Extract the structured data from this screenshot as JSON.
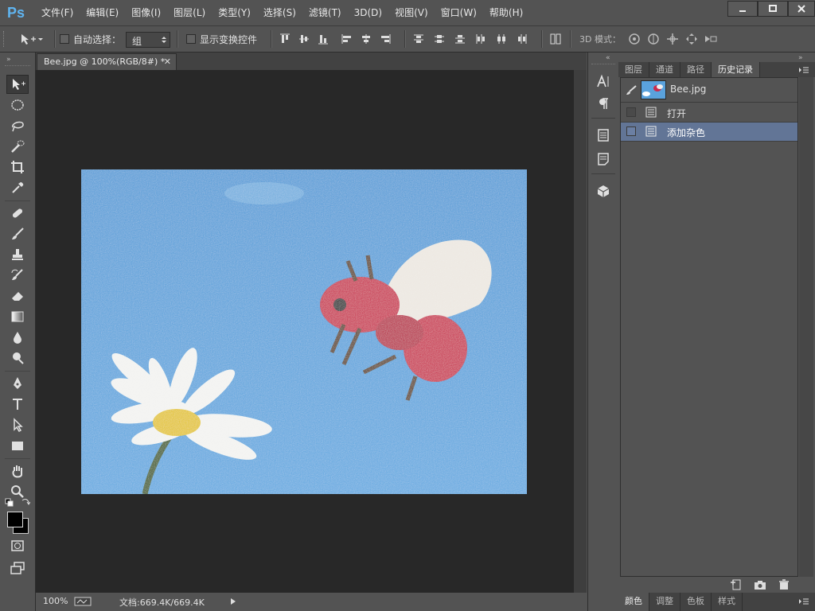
{
  "app": {
    "logo": "Ps"
  },
  "menu": [
    "文件(F)",
    "编辑(E)",
    "图像(I)",
    "图层(L)",
    "类型(Y)",
    "选择(S)",
    "滤镜(T)",
    "3D(D)",
    "视图(V)",
    "窗口(W)",
    "帮助(H)"
  ],
  "window_controls": [
    "minimize-icon",
    "maximize-icon",
    "close-icon"
  ],
  "options": {
    "auto_select_label": "自动选择：",
    "auto_select_value": "组",
    "show_transform_label": "显示变换控件",
    "mode_3d_label": "3D 模式："
  },
  "document": {
    "tab_title": "Bee.jpg @ 100%(RGB/8#) *",
    "zoom": "100%",
    "doc_size": "文档:669.4K/669.4K"
  },
  "panel": {
    "tabs": [
      "图层",
      "通道",
      "路径",
      "历史记录"
    ],
    "active_tab": "历史记录",
    "snapshot_name": "Bee.jpg",
    "history": [
      "打开",
      "添加杂色"
    ],
    "selected_history": "添加杂色"
  },
  "bottom_panel": {
    "tabs": [
      "颜色",
      "调整",
      "色板",
      "样式"
    ],
    "active_tab": "颜色"
  },
  "colors": {
    "accent_selected": "#627596",
    "logo": "#5fb4f0",
    "canvas_bg": "#282828"
  }
}
